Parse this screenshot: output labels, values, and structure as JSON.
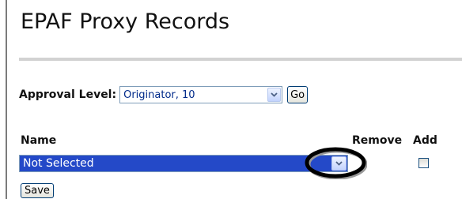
{
  "header": {
    "title": "EPAF Proxy Records"
  },
  "approval": {
    "label": "Approval Level:",
    "selected": "Originator, 10",
    "go_label": "Go"
  },
  "table": {
    "columns": {
      "name": "Name",
      "remove": "Remove",
      "add": "Add"
    },
    "row": {
      "name_selected": "Not Selected",
      "add_checked": false
    }
  },
  "actions": {
    "save_label": "Save"
  },
  "icons": {
    "dropdown": "chevron-down-icon",
    "annotation": "highlight-circle-icon"
  },
  "colors": {
    "selected_bg": "#2449c8",
    "dropdown_text": "#002a8a",
    "annotation": "#000000"
  }
}
